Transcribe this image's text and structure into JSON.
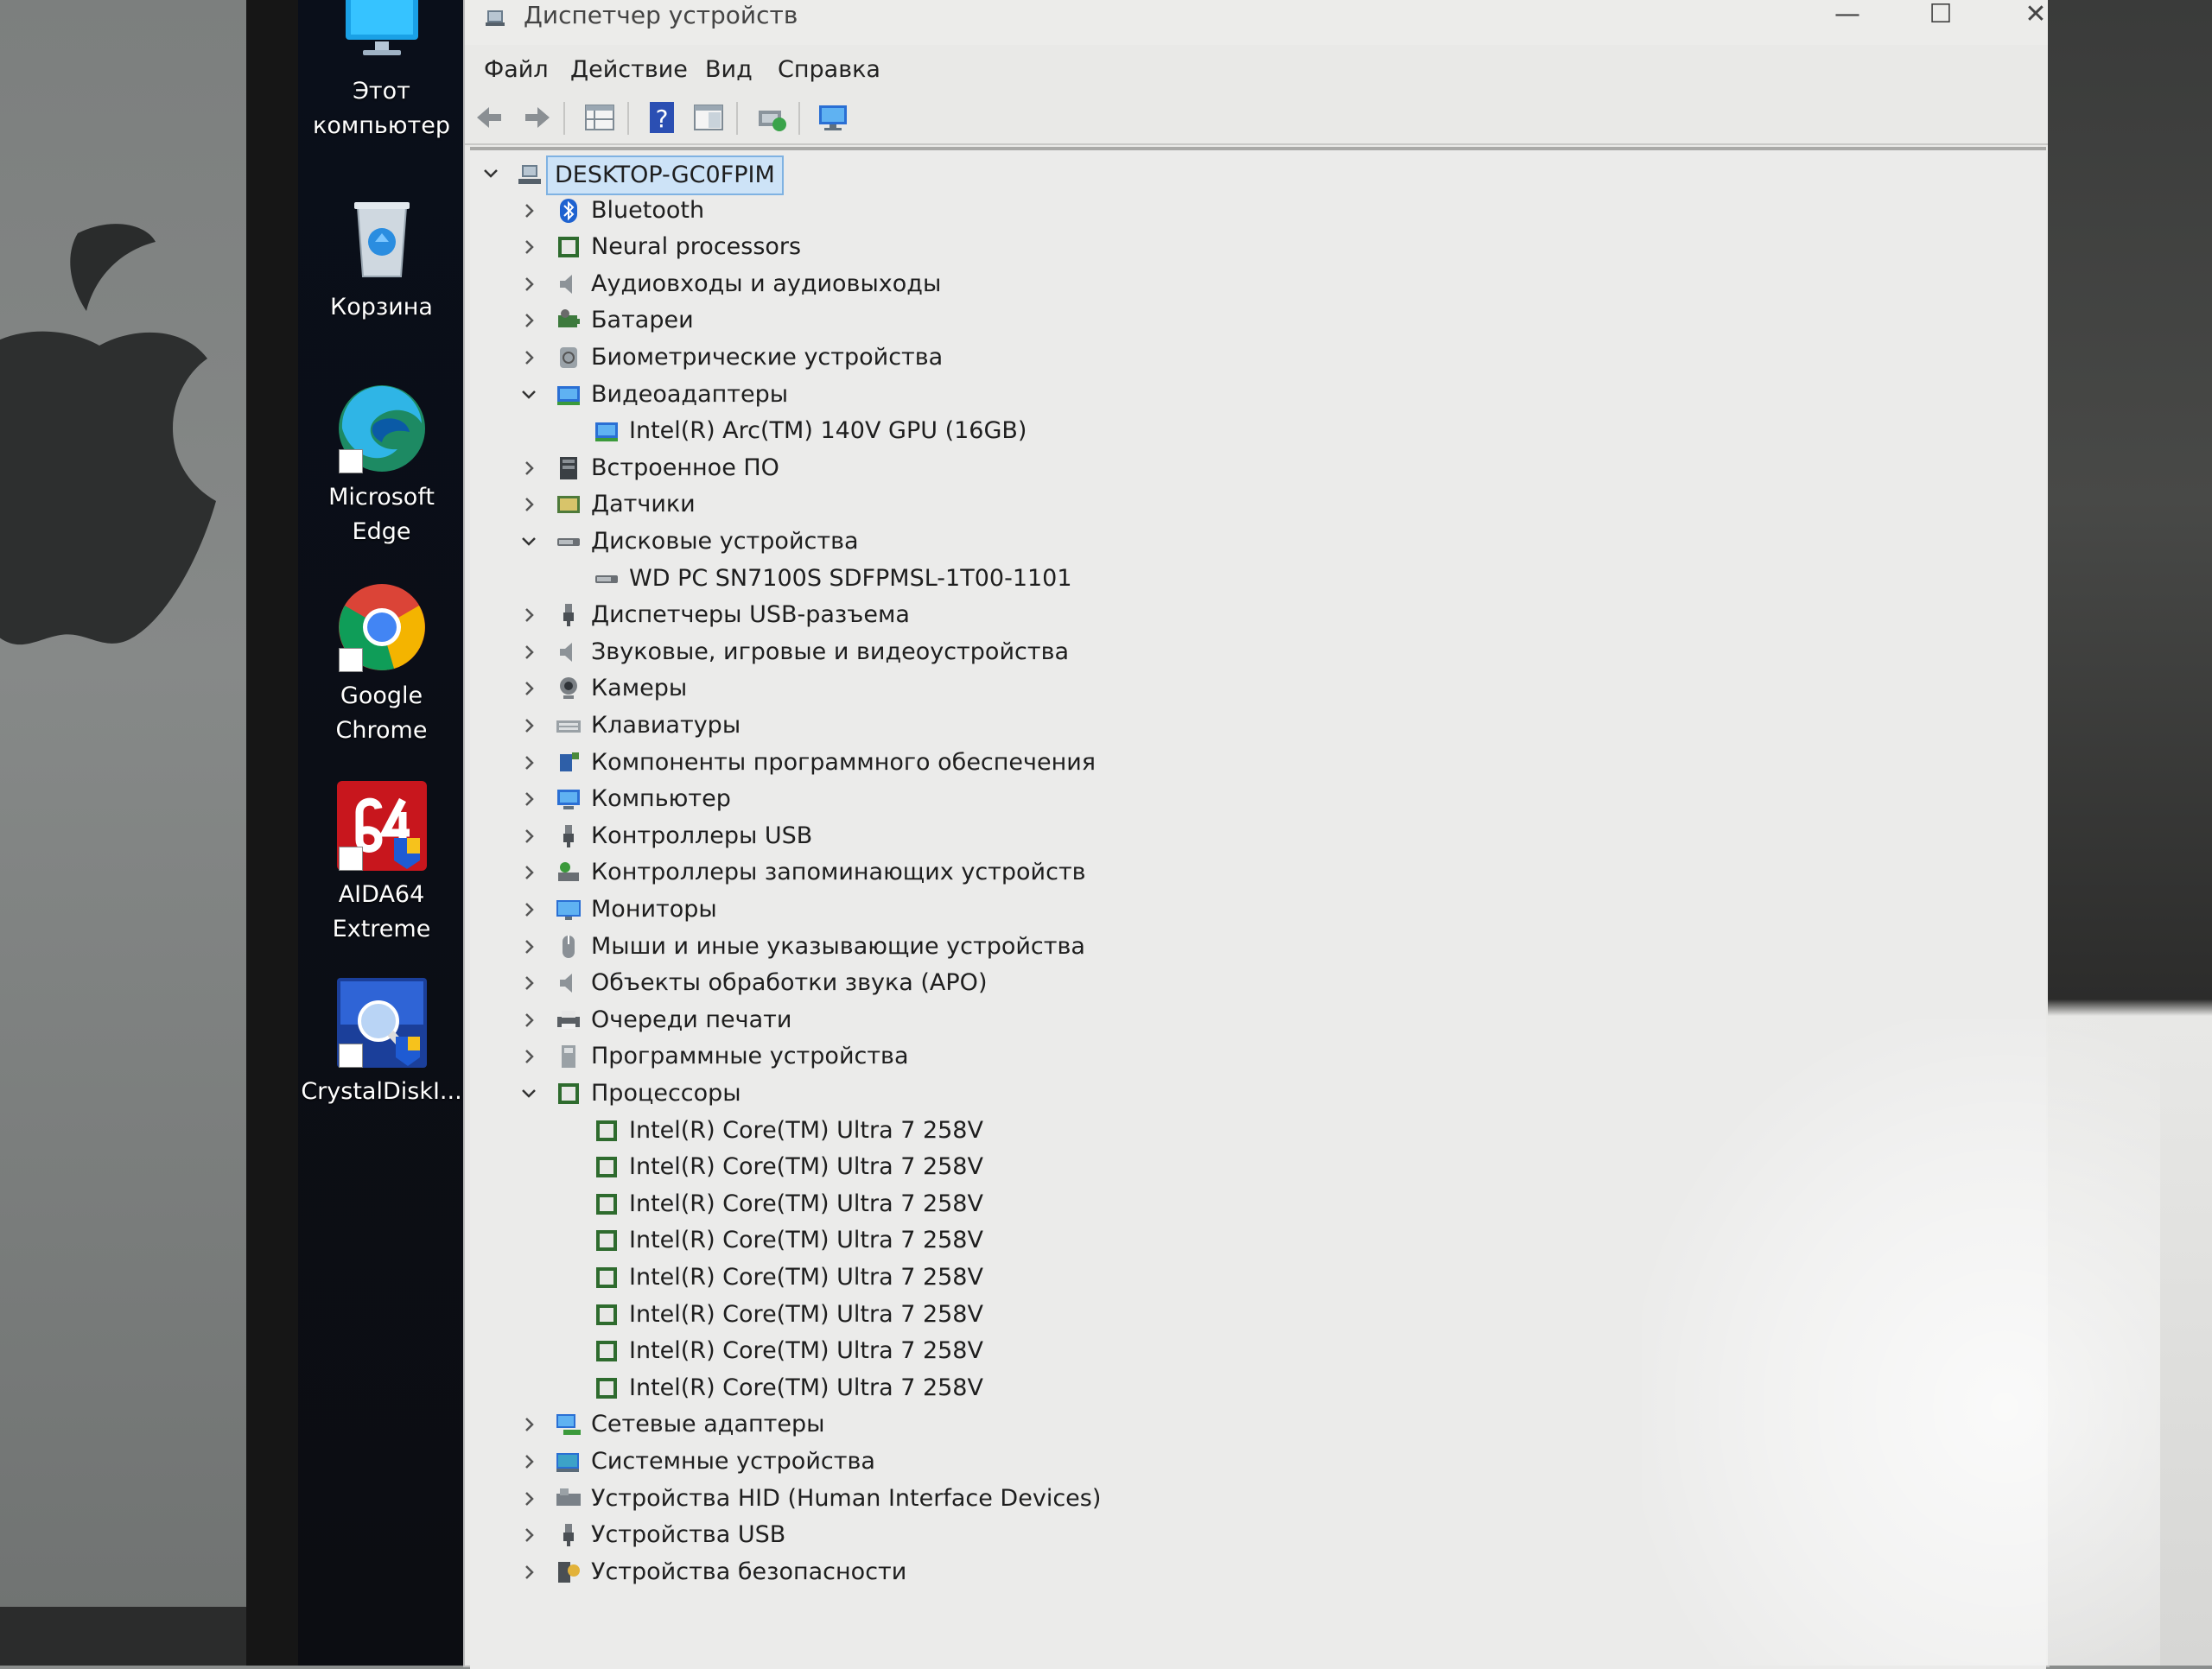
{
  "desktop_icons": [
    {
      "name": "this-pc",
      "label": "Этот\nкомпьютер"
    },
    {
      "name": "recycle-bin",
      "label": "Корзина"
    },
    {
      "name": "microsoft-edge",
      "label": "Microsoft\nEdge"
    },
    {
      "name": "google-chrome",
      "label": "Google\nChrome"
    },
    {
      "name": "aida64",
      "label": "AIDA64\nExtreme"
    },
    {
      "name": "crystaldisk",
      "label": "CrystalDiskI..."
    }
  ],
  "window": {
    "title": "Диспетчер устройств",
    "minimize": "—",
    "maximize": "☐",
    "close": "✕"
  },
  "menu": {
    "file": "Файл",
    "action": "Действие",
    "view": "Вид",
    "help": "Справка"
  },
  "toolbar": {
    "icons": [
      "back-arrow-icon",
      "forward-arrow-icon",
      "properties-grid-icon",
      "help-icon",
      "panel-icon",
      "update-driver-icon",
      "monitor-scan-icon"
    ]
  },
  "tree": {
    "root": "DESKTOP-GC0FPIM",
    "items": [
      {
        "label": "Bluetooth",
        "level": 1,
        "expanded": false,
        "icon": "bluetooth-icon"
      },
      {
        "label": "Neural processors",
        "level": 1,
        "expanded": false,
        "icon": "chip-icon"
      },
      {
        "label": "Аудиовходы и аудиовыходы",
        "level": 1,
        "expanded": false,
        "icon": "speaker-icon"
      },
      {
        "label": "Батареи",
        "level": 1,
        "expanded": false,
        "icon": "battery-icon"
      },
      {
        "label": "Биометрические устройства",
        "level": 1,
        "expanded": false,
        "icon": "fingerprint-icon"
      },
      {
        "label": "Видеоадаптеры",
        "level": 1,
        "expanded": true,
        "icon": "display-adapter-icon"
      },
      {
        "label": "Intel(R) Arc(TM) 140V GPU (16GB)",
        "level": 2,
        "icon": "display-adapter-icon"
      },
      {
        "label": "Встроенное ПО",
        "level": 1,
        "expanded": false,
        "icon": "firmware-icon"
      },
      {
        "label": "Датчики",
        "level": 1,
        "expanded": false,
        "icon": "sensor-icon"
      },
      {
        "label": "Дисковые устройства",
        "level": 1,
        "expanded": true,
        "icon": "disk-icon"
      },
      {
        "label": "WD PC SN7100S SDFPMSL-1T00-1101",
        "level": 2,
        "icon": "disk-icon"
      },
      {
        "label": "Диспетчеры USB-разъема",
        "level": 1,
        "expanded": false,
        "icon": "usb-plug-icon"
      },
      {
        "label": "Звуковые, игровые и видеоустройства",
        "level": 1,
        "expanded": false,
        "icon": "speaker-icon"
      },
      {
        "label": "Камеры",
        "level": 1,
        "expanded": false,
        "icon": "camera-icon"
      },
      {
        "label": "Клавиатуры",
        "level": 1,
        "expanded": false,
        "icon": "keyboard-icon"
      },
      {
        "label": "Компоненты программного обеспечения",
        "level": 1,
        "expanded": false,
        "icon": "software-component-icon"
      },
      {
        "label": "Компьютер",
        "level": 1,
        "expanded": false,
        "icon": "computer-icon"
      },
      {
        "label": "Контроллеры USB",
        "level": 1,
        "expanded": false,
        "icon": "usb-plug-icon"
      },
      {
        "label": "Контроллеры запоминающих устройств",
        "level": 1,
        "expanded": false,
        "icon": "storage-controller-icon"
      },
      {
        "label": "Мониторы",
        "level": 1,
        "expanded": false,
        "icon": "monitor-icon"
      },
      {
        "label": "Мыши и иные указывающие устройства",
        "level": 1,
        "expanded": false,
        "icon": "mouse-icon"
      },
      {
        "label": "Объекты обработки звука (APO)",
        "level": 1,
        "expanded": false,
        "icon": "speaker-icon"
      },
      {
        "label": "Очереди печати",
        "level": 1,
        "expanded": false,
        "icon": "printer-icon"
      },
      {
        "label": "Программные устройства",
        "level": 1,
        "expanded": false,
        "icon": "software-device-icon"
      },
      {
        "label": "Процессоры",
        "level": 1,
        "expanded": true,
        "icon": "chip-icon"
      },
      {
        "label": "Intel(R) Core(TM) Ultra 7 258V",
        "level": 2,
        "icon": "chip-icon"
      },
      {
        "label": "Intel(R) Core(TM) Ultra 7 258V",
        "level": 2,
        "icon": "chip-icon"
      },
      {
        "label": "Intel(R) Core(TM) Ultra 7 258V",
        "level": 2,
        "icon": "chip-icon"
      },
      {
        "label": "Intel(R) Core(TM) Ultra 7 258V",
        "level": 2,
        "icon": "chip-icon"
      },
      {
        "label": "Intel(R) Core(TM) Ultra 7 258V",
        "level": 2,
        "icon": "chip-icon"
      },
      {
        "label": "Intel(R) Core(TM) Ultra 7 258V",
        "level": 2,
        "icon": "chip-icon"
      },
      {
        "label": "Intel(R) Core(TM) Ultra 7 258V",
        "level": 2,
        "icon": "chip-icon"
      },
      {
        "label": "Intel(R) Core(TM) Ultra 7 258V",
        "level": 2,
        "icon": "chip-icon"
      },
      {
        "label": "Сетевые адаптеры",
        "level": 1,
        "expanded": false,
        "icon": "network-adapter-icon"
      },
      {
        "label": "Системные устройства",
        "level": 1,
        "expanded": false,
        "icon": "system-device-icon"
      },
      {
        "label": "Устройства HID (Human Interface Devices)",
        "level": 1,
        "expanded": false,
        "icon": "hid-icon"
      },
      {
        "label": "Устройства USB",
        "level": 1,
        "expanded": false,
        "icon": "usb-plug-icon"
      },
      {
        "label": "Устройства безопасности",
        "level": 1,
        "expanded": false,
        "icon": "security-device-icon"
      }
    ]
  }
}
